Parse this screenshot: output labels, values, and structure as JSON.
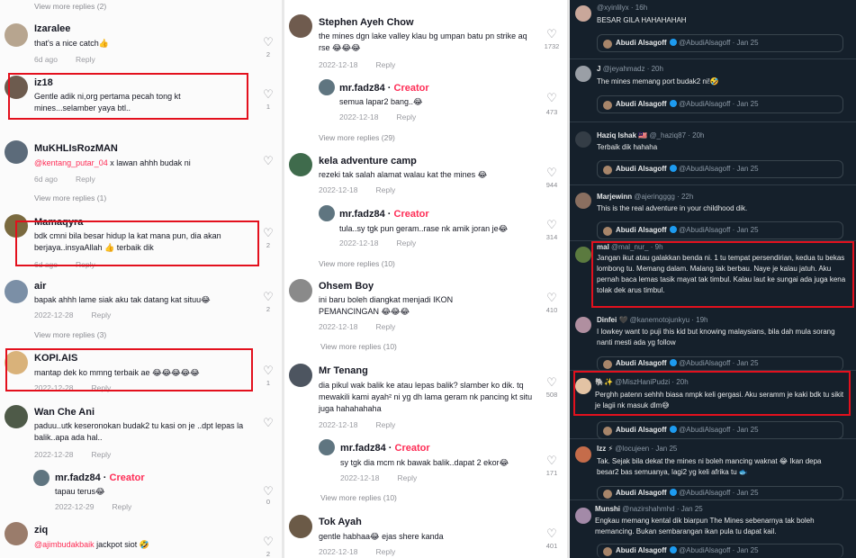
{
  "col1": {
    "view_more_top": "View more replies (2)",
    "comments": [
      {
        "user": "Izaralee",
        "text": "that's a nice catch👍",
        "date": "6d ago",
        "reply": "Reply",
        "likes": "2"
      },
      {
        "user": "iz18",
        "text": "Gentle adik ni,org pertama pecah tong kt mines...selamber yaya btl..",
        "date": "",
        "reply": "",
        "likes": "1"
      },
      {
        "user": "MuKHLIsRozMAN",
        "mention": "@kentang_putar_04",
        "text": " x lawan ahhh budak ni",
        "date": "6d ago",
        "reply": "Reply",
        "likes": ""
      },
      {
        "user": "Mamaqyra",
        "text": "bdk cmni bila besar hidup la kat mana pun, dia akan berjaya..insyaAllah 👍 terbaik dik",
        "date": "6d ago",
        "reply": "Reply",
        "likes": "2"
      },
      {
        "user": "air",
        "text": "bapak ahhh lame siak aku tak datang kat situu😂",
        "date": "2022-12-28",
        "reply": "Reply",
        "likes": "2"
      },
      {
        "user": "KOPI.AIS",
        "text": "mantap dek ko mmng terbaik ae 😂😂😂😂😂",
        "date": "2022-12-28",
        "reply": "Reply",
        "likes": "1"
      },
      {
        "user": "Wan Che Ani",
        "text": "paduu..utk keseronokan budak2 tu kasi on je ..dpt lepas la balik..apa ada hal..",
        "date": "2022-12-28",
        "reply": "Reply",
        "likes": ""
      },
      {
        "user": "ziq",
        "mention": "@ajimbudakbaik",
        "text": " jackpot siot 🤣",
        "date": "",
        "reply": "",
        "likes": "2"
      }
    ],
    "view_more_1": "View more replies (1)",
    "view_more_3": "View more replies (3)",
    "reply": {
      "user": "mr.fadz84",
      "creator": "Creator",
      "text": "tapau terus😂",
      "date": "2022-12-29",
      "reply": "Reply",
      "likes": "0"
    }
  },
  "col2": {
    "comments": [
      {
        "user": "Stephen Ayeh Chow",
        "text": "the mines dgn lake valley klau bg umpan batu pn strike aq rse 😂😂😂",
        "date": "2022-12-18",
        "reply": "Reply",
        "likes": "1732"
      },
      {
        "user": "kela adventure camp",
        "text": "rezeki tak salah alamat walau kat the mines 😂",
        "date": "2022-12-18",
        "reply": "Reply",
        "likes": "944"
      },
      {
        "user": "Ohsem Boy",
        "text": "ini baru boleh diangkat menjadi IKON PEMANCINGAN 😂😂😂",
        "date": "2022-12-18",
        "reply": "Reply",
        "likes": "410"
      },
      {
        "user": "Mr Tenang",
        "text": "dia pikul wak balik ke atau lepas balik? slamber ko dik. tq mewakili kami ayah² ni yg dh lama geram nk pancing kt situ juga hahahahaha",
        "date": "2022-12-18",
        "reply": "Reply",
        "likes": "508"
      },
      {
        "user": "Tok Ayah",
        "text": "gentle habhaa😂 ejas shere kanda",
        "date": "2022-12-18",
        "reply": "Reply",
        "likes": "401"
      }
    ],
    "replies": [
      {
        "user": "mr.fadz84",
        "creator": "Creator",
        "text": "semua lapar2 bang..😂",
        "date": "2022-12-18",
        "reply": "Reply",
        "likes": "473"
      },
      {
        "user": "mr.fadz84",
        "creator": "Creator",
        "text": "tula..sy tgk pun geram..rase nk amik joran je😂",
        "date": "2022-12-18",
        "reply": "Reply",
        "likes": "314"
      },
      {
        "user": "mr.fadz84",
        "creator": "Creator",
        "text": "sy tgk dia mcm nk bawak balik..dapat 2 ekor😂",
        "date": "2022-12-18",
        "reply": "Reply",
        "likes": "171"
      }
    ],
    "view_more": [
      "View more replies (29)",
      "View more replies (10)",
      "View more replies (10)"
    ]
  },
  "col3": {
    "quote_name": "Abudi Alsagoff",
    "quote_handle": "@AbudiAlsagoff · Jan 25",
    "tweets": [
      {
        "name": "",
        "handle": "@xyinlilyx · 16h",
        "text": "BESAR GILA HAHAHAHAH"
      },
      {
        "name": "J",
        "handle": "@jeyahmadz · 20h",
        "text": "The mines memang port budak2 ni!🤣"
      },
      {
        "name": "Haziq Ishak 🇲🇾",
        "handle": "@_haziq87 · 20h",
        "text": "Terbaik dik hahaha"
      },
      {
        "name": "Marjewinn",
        "handle": "@ajeringggg · 22h",
        "text": "This is the real adventure in your childhood dik."
      },
      {
        "name": "mal",
        "handle": "@mal_nur_ · 9h",
        "text": "Jangan ikut atau galakkan benda ni. 1 tu tempat persendirian, kedua tu bekas lombong tu. Memang dalam. Malang tak berbau. Naye je kalau jatuh. Aku pernah baca lemas tasik mayat tak timbul. Kalau laut ke sungai ada juga kena tolak dek arus timbul."
      },
      {
        "name": "Dinfei 🖤",
        "handle": "@kanemotojunkyu · 19h",
        "text": "I lowkey want to puji this kid but knowing malaysians, bila dah mula sorang nanti mesti ada yg follow"
      },
      {
        "name": "🐘✨",
        "handle": "@MiszHaniPudzi · 20h",
        "text": "Perghh patenn sehhh biasa nmpk keli gergasi. Aku seramm je kaki bdk tu sikit je lagii nk masuk dlm😅"
      },
      {
        "name": "Izz ⚡",
        "handle": "@locujeen · Jan 25",
        "text": "Tak. Sejak bila dekat the mines ni boleh mancing waknat 😂 Ikan depa besar2 bas semuanya, lagi2 yg keli afrika tu 🐟"
      },
      {
        "name": "Munshi",
        "handle": "@nazirshahmhd · Jan 25",
        "text": "Engkau memang kental dik biarpun The Mines sebenarnya tak boleh memancing. Bukan sembarangan ikan pula tu dapat kail."
      }
    ]
  }
}
